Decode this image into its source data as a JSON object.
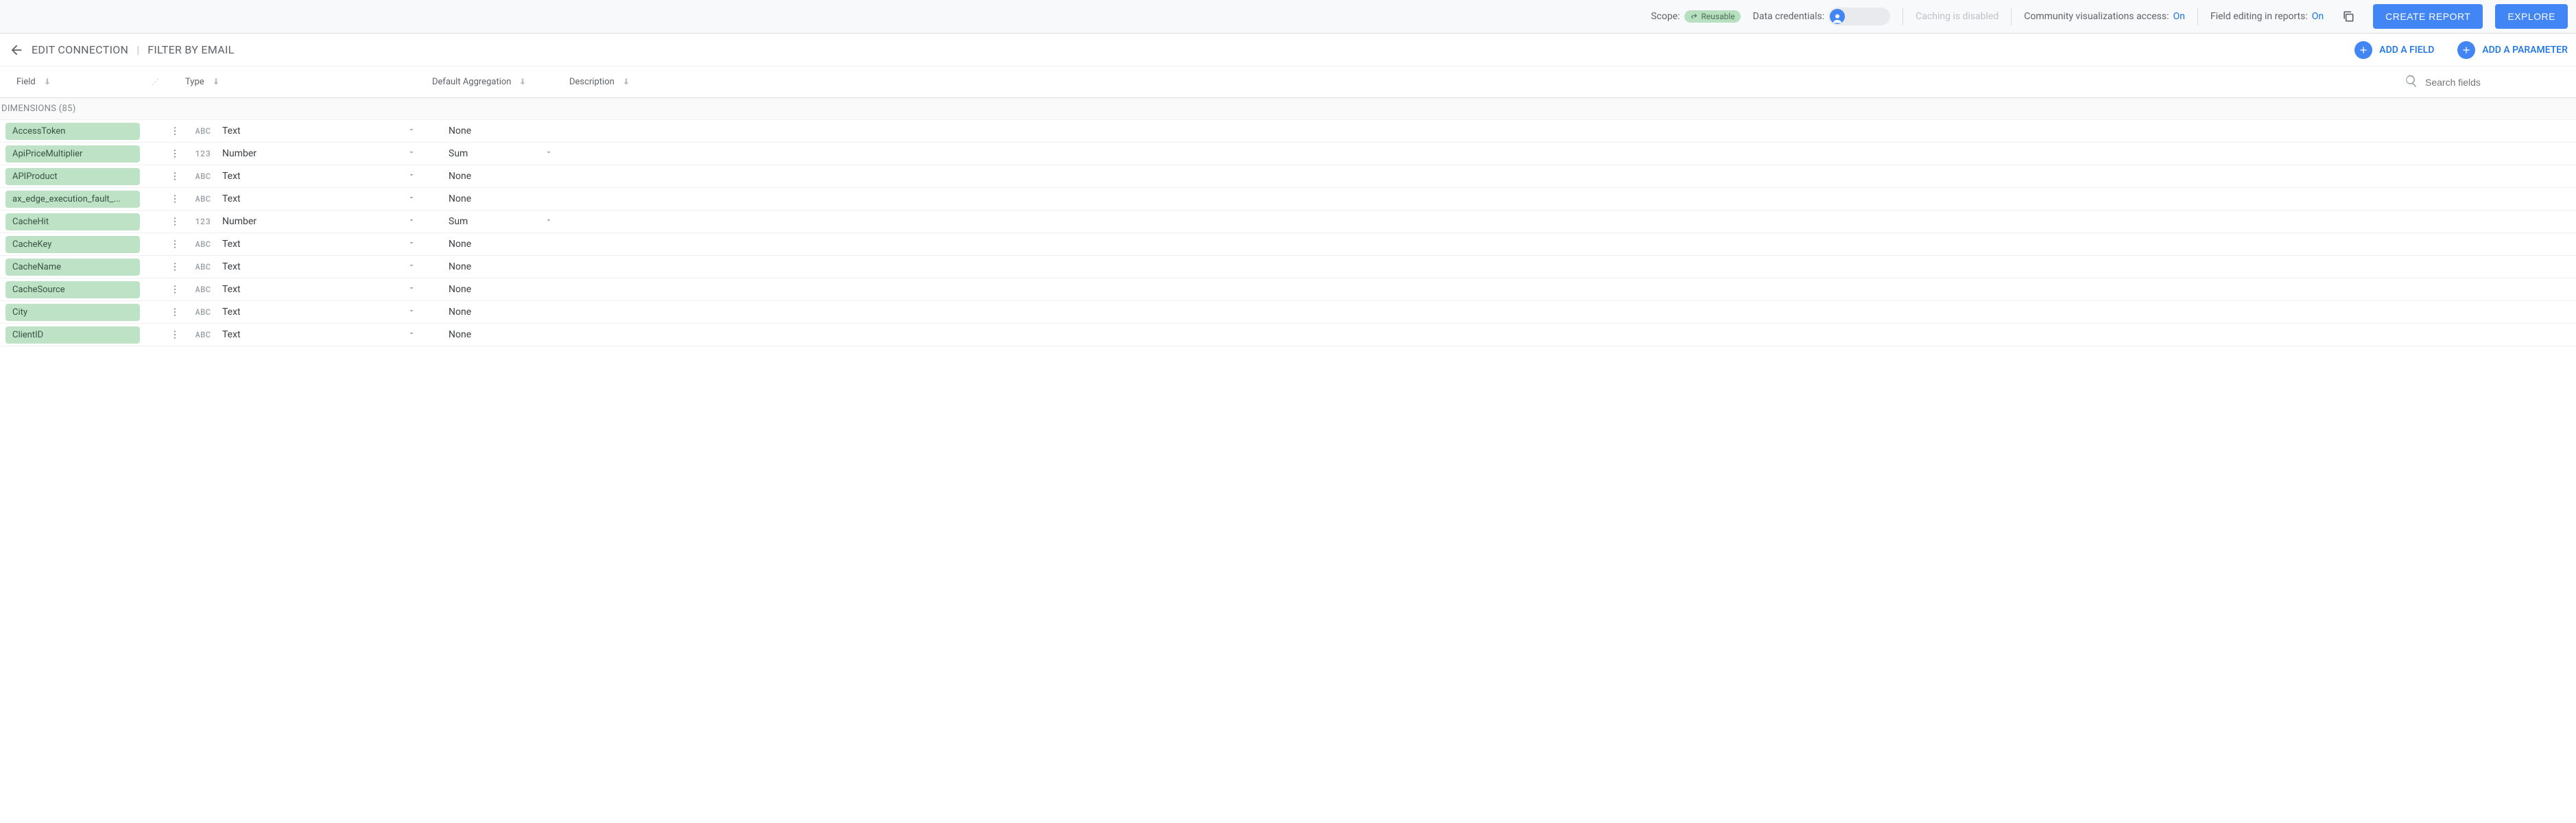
{
  "config": {
    "scope_label": "Scope:",
    "scope_value": "Reusable",
    "credentials_label": "Data credentials:",
    "caching_text": "Caching is disabled",
    "community_viz_label": "Community visualizations access:",
    "community_viz_value": "On",
    "field_editing_label": "Field editing in reports:",
    "field_editing_value": "On",
    "create_report_label": "CREATE REPORT",
    "explore_label": "EXPLORE"
  },
  "nav": {
    "edit_connection": "EDIT CONNECTION",
    "filter_by_email": "FILTER BY EMAIL",
    "add_field_label": "ADD A FIELD",
    "add_parameter_label": "ADD A PARAMETER"
  },
  "headers": {
    "field": "Field",
    "type": "Type",
    "default_aggregation": "Default Aggregation",
    "description": "Description",
    "search_placeholder": "Search fields"
  },
  "group": {
    "label": "DIMENSIONS",
    "count": 85
  },
  "rows": [
    {
      "name": "AccessToken",
      "type_glyph": "ABC",
      "type": "Text",
      "agg": "None",
      "agg_dropdown": false
    },
    {
      "name": "ApiPriceMultiplier",
      "type_glyph": "123",
      "type": "Number",
      "agg": "Sum",
      "agg_dropdown": true
    },
    {
      "name": "APIProduct",
      "type_glyph": "ABC",
      "type": "Text",
      "agg": "None",
      "agg_dropdown": false
    },
    {
      "name": "ax_edge_execution_fault_...",
      "type_glyph": "ABC",
      "type": "Text",
      "agg": "None",
      "agg_dropdown": false
    },
    {
      "name": "CacheHit",
      "type_glyph": "123",
      "type": "Number",
      "agg": "Sum",
      "agg_dropdown": true
    },
    {
      "name": "CacheKey",
      "type_glyph": "ABC",
      "type": "Text",
      "agg": "None",
      "agg_dropdown": false
    },
    {
      "name": "CacheName",
      "type_glyph": "ABC",
      "type": "Text",
      "agg": "None",
      "agg_dropdown": false
    },
    {
      "name": "CacheSource",
      "type_glyph": "ABC",
      "type": "Text",
      "agg": "None",
      "agg_dropdown": false
    },
    {
      "name": "City",
      "type_glyph": "ABC",
      "type": "Text",
      "agg": "None",
      "agg_dropdown": false
    },
    {
      "name": "ClientID",
      "type_glyph": "ABC",
      "type": "Text",
      "agg": "None",
      "agg_dropdown": false
    }
  ]
}
